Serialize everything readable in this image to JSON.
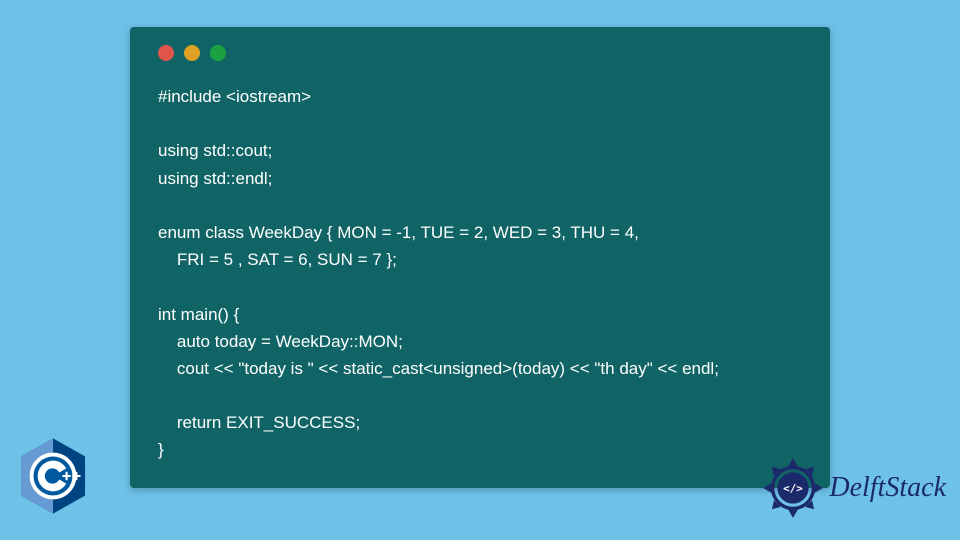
{
  "window": {
    "traffic_lights": [
      "red",
      "yellow",
      "green"
    ]
  },
  "code": {
    "lines": [
      "#include <iostream>",
      "",
      "using std::cout;",
      "using std::endl;",
      "",
      "enum class WeekDay { MON = -1, TUE = 2, WED = 3, THU = 4,",
      "    FRI = 5 , SAT = 6, SUN = 7 };",
      "",
      "int main() {",
      "    auto today = WeekDay::MON;",
      "    cout << \"today is \" << static_cast<unsigned>(today) << \"th day\" << endl;",
      "",
      "    return EXIT_SUCCESS;",
      "}"
    ]
  },
  "logos": {
    "cpp_label": "C++",
    "delftstack_label": "DelftStack"
  },
  "colors": {
    "background": "#6ec2e8",
    "code_bg": "#116466",
    "code_fg": "#ffffff",
    "cpp_blue": "#004482",
    "cpp_light": "#659ad2",
    "ds_blue": "#1b2a6b"
  }
}
